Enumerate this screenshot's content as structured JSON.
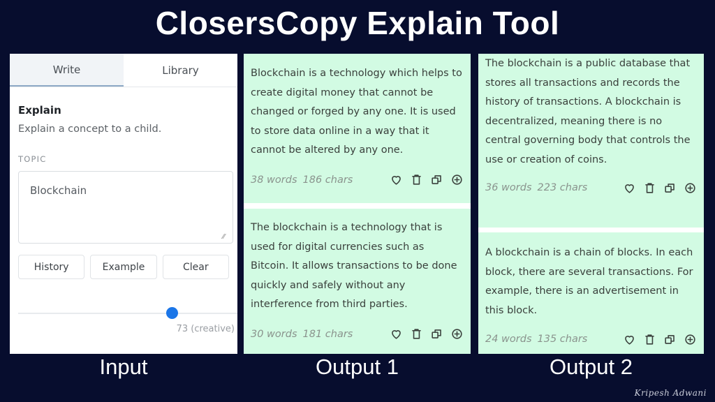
{
  "title": "ClosersCopy Explain Tool",
  "input_panel": {
    "tabs": [
      {
        "label": "Write",
        "active": true
      },
      {
        "label": "Library",
        "active": false
      }
    ],
    "tool_title": "Explain",
    "tool_description": "Explain a concept to a child.",
    "topic_label": "TOPIC",
    "topic_value": "Blockchain",
    "buttons": {
      "history": "History",
      "example": "Example",
      "clear": "Clear"
    },
    "creativity": {
      "value": 73,
      "max": 100,
      "label": "73 (creative)"
    },
    "accent_color": "#1b76e8"
  },
  "outputs": [
    {
      "caption": "Output 1",
      "cards": [
        {
          "text": "Blockchain is a technology which helps to create digital money that cannot be changed or forged by any one. It is used to store data online in a way that it cannot be altered by any one.",
          "words": "38 words",
          "chars": "186 chars"
        },
        {
          "text": "The blockchain is a technology that is used for digital currencies such as Bitcoin. It allows transactions to be done quickly and safely without any interference from third parties.",
          "words": "30 words",
          "chars": "181 chars"
        }
      ]
    },
    {
      "caption": "Output 2",
      "cards": [
        {
          "text": "The blockchain is a public database that stores all transactions and records the history of transactions. A blockchain is decentralized, meaning there is no central governing body that controls the use or creation of coins.",
          "words": "36 words",
          "chars": "223 chars"
        },
        {
          "text": "A blockchain is a chain of blocks. In each block, there are several transactions. For example, there is an advertisement in this block.",
          "words": "24 words",
          "chars": "135 chars"
        }
      ]
    }
  ],
  "card_icons": [
    "heart-icon",
    "trash-icon",
    "copy-icon",
    "plus-circle-icon"
  ],
  "captions": {
    "input": "Input"
  },
  "signature": "Kripesh Adwani",
  "colors": {
    "background": "#070d2e",
    "card": "#d2fbe3"
  }
}
